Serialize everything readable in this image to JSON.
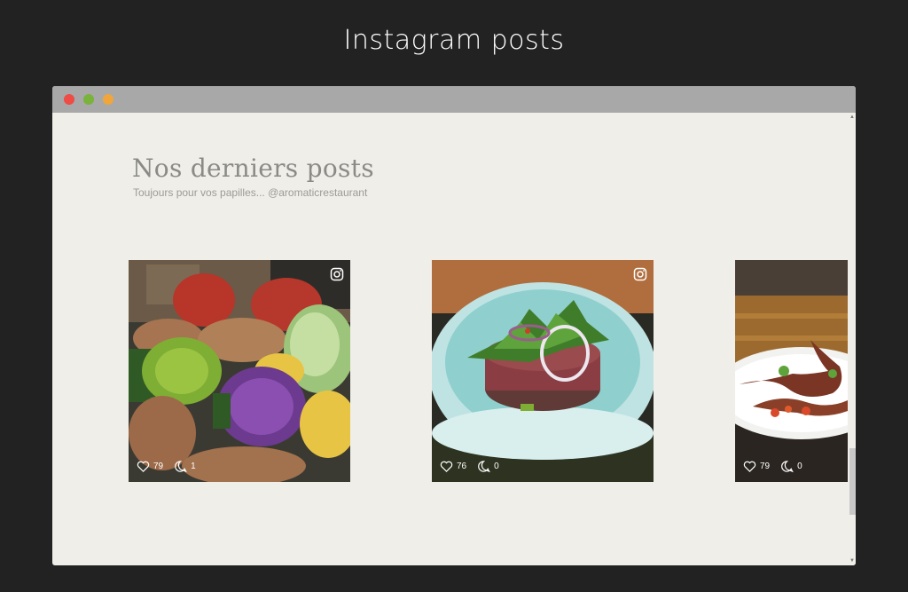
{
  "page": {
    "title": "Instagram posts"
  },
  "section": {
    "heading": "Nos derniers posts",
    "subheading": "Toujours pour vos papilles... @aromaticrestaurant"
  },
  "posts": [
    {
      "likes": "79",
      "comments": "1",
      "subject": "vegetables"
    },
    {
      "likes": "76",
      "comments": "0",
      "subject": "beef-tartare"
    },
    {
      "likes": "79",
      "comments": "0",
      "subject": "octopus-dish"
    }
  ],
  "colors": {
    "background": "#222222",
    "window": "#f0eee9",
    "titlebar": "#a8a8a8",
    "close": "#ee4c45",
    "minimize": "#7ab33b",
    "zoom": "#f0a63c"
  },
  "icons": [
    "instagram-icon",
    "heart-icon",
    "comment-icon"
  ]
}
